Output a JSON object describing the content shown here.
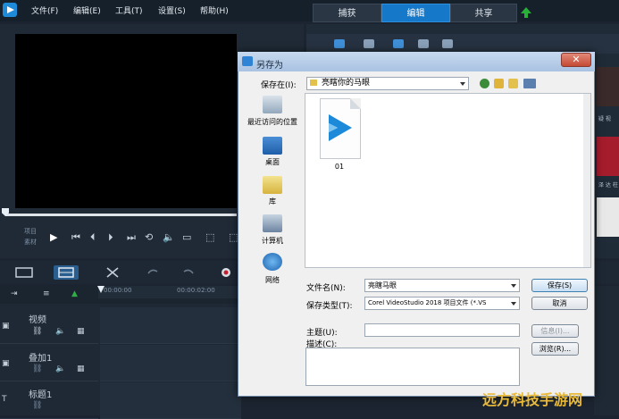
{
  "menu": {
    "items": [
      "文件(F)",
      "编辑(E)",
      "工具(T)",
      "设置(S)",
      "帮助(H)"
    ]
  },
  "mode_tabs": [
    "捕获",
    "编辑",
    "共享"
  ],
  "player": {
    "mode_project": "项目",
    "mode_clip": "素材"
  },
  "timeline": {
    "ruler": [
      "00:00:00",
      "00:00:02:00"
    ],
    "tracks": [
      "视频",
      "叠加1",
      "标题1"
    ]
  },
  "right_strip": {
    "label1": "疑 视",
    "label2": "泽 达 柱"
  },
  "dialog": {
    "title": "另存为",
    "save_in_label": "保存在(I):",
    "save_in_value": "亮瞎你的马眼",
    "places": [
      "最近访问的位置",
      "桌面",
      "库",
      "计算机",
      "网络"
    ],
    "files": [
      {
        "name": "01"
      }
    ],
    "filename_label": "文件名(N):",
    "filename_value": "亮瞎马眼",
    "filetype_label": "保存类型(T):",
    "filetype_value": "Corel VideoStudio 2018 项目文件 (*.VS",
    "subject_label": "主题(U):",
    "description_label": "描述(C):",
    "buttons": {
      "save": "保存(S)",
      "cancel": "取消",
      "info": "信息(I)...",
      "browse": "浏览(R)..."
    },
    "close": "✕"
  },
  "watermark": "远方科技手游网",
  "colors": {
    "accent": "#1678c8",
    "dialog_bg": "#f0f0f0",
    "editor_bg": "#1b2430"
  }
}
